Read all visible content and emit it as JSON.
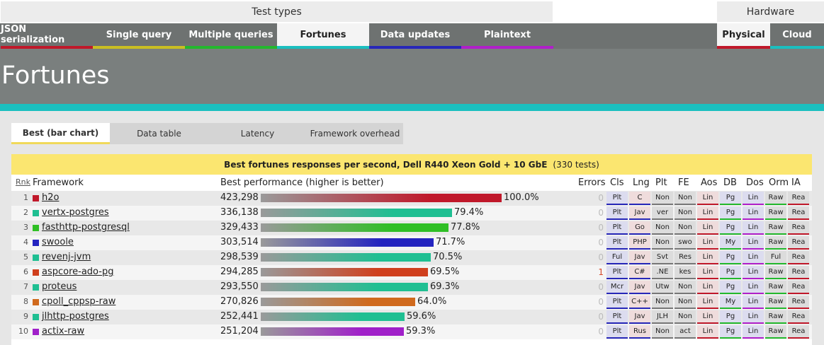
{
  "header": {
    "group_test_types": "Test types",
    "group_hardware": "Hardware"
  },
  "test_tabs": [
    {
      "label": "JSON serialization",
      "color": "#c0182a"
    },
    {
      "label": "Single query",
      "color": "#c9be22"
    },
    {
      "label": "Multiple queries",
      "color": "#23b82d"
    },
    {
      "label": "Fortunes",
      "color": "#1bbfbf"
    },
    {
      "label": "Data updates",
      "color": "#2727b8"
    },
    {
      "label": "Plaintext",
      "color": "#b01fc9"
    }
  ],
  "active_test": "Fortunes",
  "hardware_tabs": [
    {
      "label": "Physical",
      "color": "#c0182a"
    },
    {
      "label": "Cloud",
      "color": "#1bbfbf"
    }
  ],
  "active_hardware": "Physical",
  "page_title": "Fortunes",
  "view_tabs": [
    "Best (bar chart)",
    "Data table",
    "Latency",
    "Framework overhead"
  ],
  "active_view": "Best (bar chart)",
  "panel": {
    "title": "Best fortunes responses per second, Dell R440 Xeon Gold + 10 GbE",
    "tests": "(330 tests)"
  },
  "columns": {
    "rank": "Rnk",
    "framework": "Framework",
    "best": "Best performance (higher is better)",
    "errors": "Errors",
    "attrs": [
      "Cls",
      "Lng",
      "Plt",
      "FE",
      "Aos",
      "DB",
      "Dos",
      "Orm",
      "IA"
    ]
  },
  "rows": [
    {
      "rank": "1",
      "name": "h2o",
      "rps": "423,298",
      "pct": "100.0%",
      "value": 100.0,
      "color": "#c0182a",
      "errors": "0",
      "attrs": [
        "Plt",
        "C",
        "Non",
        "Non",
        "Lin",
        "Pg",
        "Lin",
        "Raw",
        "Rea"
      ]
    },
    {
      "rank": "2",
      "name": "vertx-postgres",
      "rps": "336,138",
      "pct": "79.4%",
      "value": 79.4,
      "color": "#1fbf92",
      "errors": "0",
      "attrs": [
        "Plt",
        "Jav",
        "ver",
        "Non",
        "Lin",
        "Pg",
        "Lin",
        "Raw",
        "Rea"
      ]
    },
    {
      "rank": "3",
      "name": "fasthttp-postgresql",
      "rps": "329,433",
      "pct": "77.8%",
      "value": 77.8,
      "color": "#2fbf25",
      "errors": "0",
      "attrs": [
        "Plt",
        "Go",
        "Non",
        "Non",
        "Lin",
        "Pg",
        "Lin",
        "Raw",
        "Rea"
      ]
    },
    {
      "rank": "4",
      "name": "swoole",
      "rps": "303,514",
      "pct": "71.7%",
      "value": 71.7,
      "color": "#2424c0",
      "errors": "0",
      "attrs": [
        "Plt",
        "PHP",
        "Non",
        "swo",
        "Lin",
        "My",
        "Lin",
        "Raw",
        "Rea"
      ]
    },
    {
      "rank": "5",
      "name": "revenj-jvm",
      "rps": "298,539",
      "pct": "70.5%",
      "value": 70.5,
      "color": "#1fbf92",
      "errors": "0",
      "attrs": [
        "Ful",
        "Jav",
        "Svt",
        "Res",
        "Lin",
        "Pg",
        "Lin",
        "Ful",
        "Rea"
      ]
    },
    {
      "rank": "6",
      "name": "aspcore-ado-pg",
      "rps": "294,285",
      "pct": "69.5%",
      "value": 69.5,
      "color": "#d0401e",
      "errors": "1",
      "attrs": [
        "Plt",
        "C#",
        ".NE",
        "kes",
        "Lin",
        "Pg",
        "Lin",
        "Raw",
        "Rea"
      ]
    },
    {
      "rank": "7",
      "name": "proteus",
      "rps": "293,550",
      "pct": "69.3%",
      "value": 69.3,
      "color": "#1fbf92",
      "errors": "0",
      "attrs": [
        "Mcr",
        "Jav",
        "Utw",
        "Non",
        "Lin",
        "Pg",
        "Lin",
        "Raw",
        "Rea"
      ]
    },
    {
      "rank": "8",
      "name": "cpoll_cppsp-raw",
      "rps": "270,826",
      "pct": "64.0%",
      "value": 64.0,
      "color": "#d06a1e",
      "errors": "0",
      "attrs": [
        "Plt",
        "C++",
        "Non",
        "Non",
        "Lin",
        "My",
        "Lin",
        "Raw",
        "Rea"
      ]
    },
    {
      "rank": "9",
      "name": "jlhttp-postgres",
      "rps": "252,441",
      "pct": "59.6%",
      "value": 59.6,
      "color": "#1fbf92",
      "errors": "0",
      "attrs": [
        "Plt",
        "Jav",
        "JLH",
        "Non",
        "Lin",
        "Pg",
        "Lin",
        "Raw",
        "Rea"
      ]
    },
    {
      "rank": "10",
      "name": "actix-raw",
      "rps": "251,204",
      "pct": "59.3%",
      "value": 59.3,
      "color": "#a020c9",
      "errors": "0",
      "attrs": [
        "Plt",
        "Rus",
        "Non",
        "act",
        "Lin",
        "Pg",
        "Lin",
        "Raw",
        "Rea"
      ]
    }
  ],
  "attr_colors": {
    "bg": [
      "#dcdcef",
      "#efdcdc",
      "#dcdcdc",
      "#dcdcdc",
      "#efdcdc",
      "#dcdcef",
      "#dcdcef",
      "#dcdcdc",
      "#dcdcdc"
    ],
    "line": [
      "#2727b8",
      "#2727b8",
      "#777777",
      "#777777",
      "#c0182a",
      "#23b82d",
      "#b01fc9",
      "#23b82d",
      "#c0182a"
    ]
  }
}
